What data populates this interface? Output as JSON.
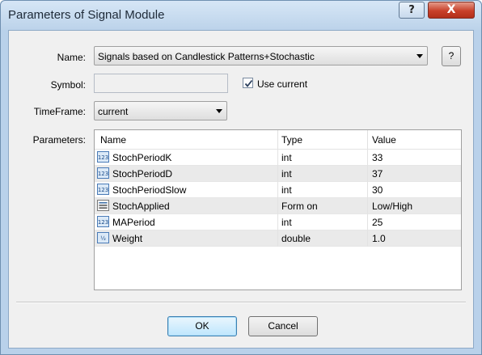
{
  "window": {
    "title": "Parameters of Signal Module",
    "help_glyph": "?",
    "close_glyph": "X"
  },
  "form": {
    "name_label": "Name:",
    "name_value": "Signals based on Candlestick Patterns+Stochastic",
    "name_help_button": "?",
    "symbol_label": "Symbol:",
    "symbol_value": "",
    "use_current_label": "Use current",
    "use_current_checked": true,
    "timeframe_label": "TimeFrame:",
    "timeframe_value": "current",
    "parameters_label": "Parameters:"
  },
  "table": {
    "columns": [
      "Name",
      "Type",
      "Value"
    ],
    "rows": [
      {
        "name": "StochPeriodK",
        "type": "int",
        "value": "33",
        "icon": "integer-icon"
      },
      {
        "name": "StochPeriodD",
        "type": "int",
        "value": "37",
        "icon": "integer-icon"
      },
      {
        "name": "StochPeriodSlow",
        "type": "int",
        "value": "30",
        "icon": "integer-icon"
      },
      {
        "name": "StochApplied",
        "type": "Form on",
        "value": "Low/High",
        "icon": "enum-list-icon"
      },
      {
        "name": "MAPeriod",
        "type": "int",
        "value": "25",
        "icon": "integer-icon"
      },
      {
        "name": "Weight",
        "type": "double",
        "value": "1.0",
        "icon": "double-icon"
      }
    ]
  },
  "buttons": {
    "ok": "OK",
    "cancel": "Cancel"
  },
  "colors": {
    "titlebar": "#c9dcef",
    "close_button": "#c8402a",
    "default_button_border": "#3c7fb1"
  }
}
